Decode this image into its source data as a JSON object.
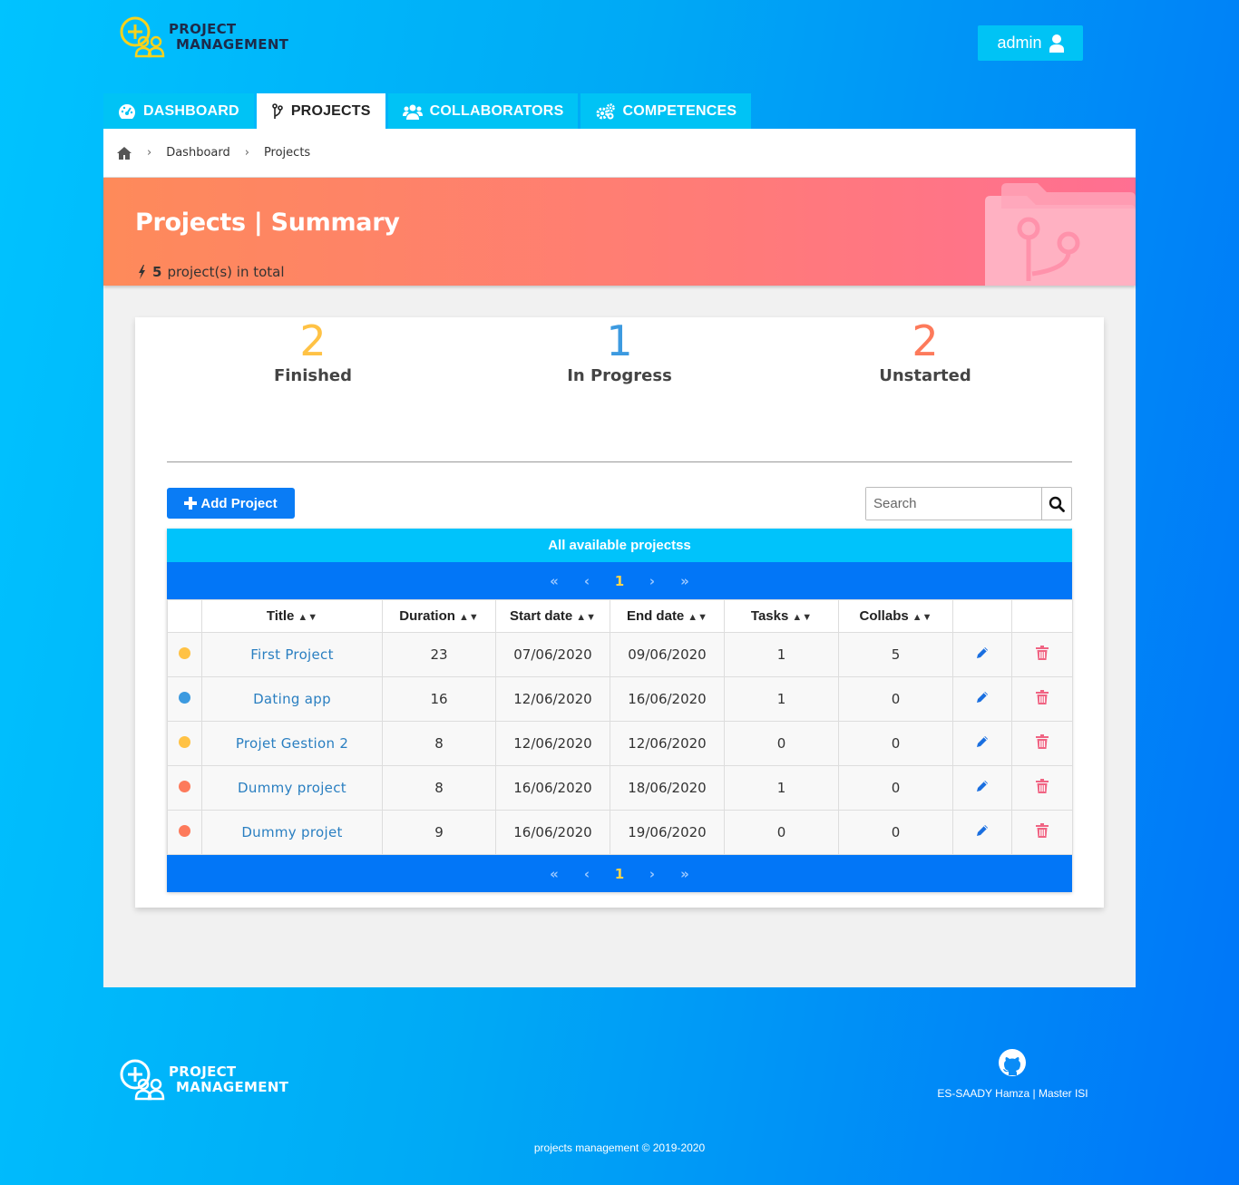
{
  "brand": {
    "line1": "PROJECT",
    "line2": "MANAGEMENT"
  },
  "user": {
    "name": "admin"
  },
  "tabs": [
    {
      "label": "DASHBOARD",
      "icon": "tachometer-icon",
      "active": false
    },
    {
      "label": "PROJECTS",
      "icon": "code-branch-icon",
      "active": true
    },
    {
      "label": "COLLABORATORS",
      "icon": "users-icon",
      "active": false
    },
    {
      "label": "COMPETENCES",
      "icon": "cogs-icon",
      "active": false
    }
  ],
  "breadcrumb": {
    "items": [
      "Dashboard",
      "Projects"
    ]
  },
  "banner": {
    "title": "Projects | Summary",
    "total_count": "5",
    "total_suffix": "project(s) in total"
  },
  "stats": {
    "finished": {
      "value": "2",
      "label": "Finished",
      "color": "#ffc245"
    },
    "in_progress": {
      "value": "1",
      "label": "In Progress",
      "color": "#3c9ae0"
    },
    "unstarted": {
      "value": "2",
      "label": "Unstarted",
      "color": "#fd7a5b"
    }
  },
  "toolbar": {
    "add_label": "Add Project",
    "search_placeholder": "Search"
  },
  "table": {
    "caption": "All available projectss",
    "pager": {
      "first": "«",
      "prev": "‹",
      "current": "1",
      "next": "›",
      "last": "»"
    },
    "columns": [
      "Title",
      "Duration",
      "Start date",
      "End date",
      "Tasks",
      "Collabs"
    ],
    "rows": [
      {
        "status_color": "#ffc245",
        "title": "First Project",
        "duration": "23",
        "start": "07/06/2020",
        "end": "09/06/2020",
        "tasks": "1",
        "collabs": "5"
      },
      {
        "status_color": "#3c9ae0",
        "title": "Dating app",
        "duration": "16",
        "start": "12/06/2020",
        "end": "16/06/2020",
        "tasks": "1",
        "collabs": "0"
      },
      {
        "status_color": "#ffc245",
        "title": "Projet Gestion 2",
        "duration": "8",
        "start": "12/06/2020",
        "end": "12/06/2020",
        "tasks": "0",
        "collabs": "0"
      },
      {
        "status_color": "#fd7a5b",
        "title": "Dummy project",
        "duration": "8",
        "start": "16/06/2020",
        "end": "18/06/2020",
        "tasks": "1",
        "collabs": "0"
      },
      {
        "status_color": "#fd7a5b",
        "title": "Dummy projet",
        "duration": "9",
        "start": "16/06/2020",
        "end": "19/06/2020",
        "tasks": "0",
        "collabs": "0"
      }
    ]
  },
  "footer": {
    "author": "ES-SAADY Hamza | Master ISI",
    "copyright": "projects management © 2019-2020"
  }
}
